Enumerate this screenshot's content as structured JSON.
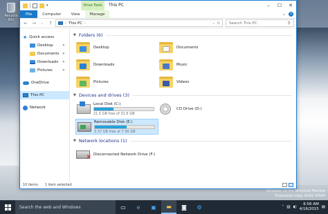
{
  "desktop": {
    "recycle_bin_label": "Recycle Bin",
    "watermark": [
      "Windows 10 Pro Technical Preview",
      "Evaluation copy. Build 10049"
    ]
  },
  "window": {
    "title": "This PC",
    "contextual_tab": "Drive Tools",
    "tabs": [
      "File",
      "Computer",
      "View",
      "Manage"
    ],
    "address": {
      "root": "This PC",
      "search_placeholder": "Search This PC"
    },
    "nav": {
      "quick_access": "Quick access",
      "pinned": [
        "Desktop",
        "Documents",
        "Downloads",
        "Pictures"
      ],
      "onedrive": "OneDrive",
      "this_pc": "This PC",
      "network": "Network"
    },
    "folders_header": "Folders (6)",
    "folders": [
      "Desktop",
      "Documents",
      "Downloads",
      "Music",
      "Pictures",
      "Videos"
    ],
    "devices_header": "Devices and drives (3)",
    "drives": [
      {
        "name": "Local Disk (C:)",
        "free": "21.5 GB free of 31.6 GB",
        "used_pct": 32
      },
      {
        "name": "CD Drive (D:)"
      },
      {
        "name": "Removable Disk (E:)",
        "free": "3.37 GB free of 7.30 GB",
        "used_pct": 54
      }
    ],
    "network_header": "Network locations (1)",
    "network_drive": "Disconnected Network Drive (F:)",
    "status": {
      "items": "10 items",
      "selected": "1 item selected"
    }
  },
  "taskbar": {
    "search_placeholder": "Search the web and Windows",
    "time": "6:56 AM",
    "date": "4/16/2015"
  },
  "colors": {
    "accent": "#1979ca",
    "selection": "#cce8ff",
    "bar": "#26a0da"
  }
}
